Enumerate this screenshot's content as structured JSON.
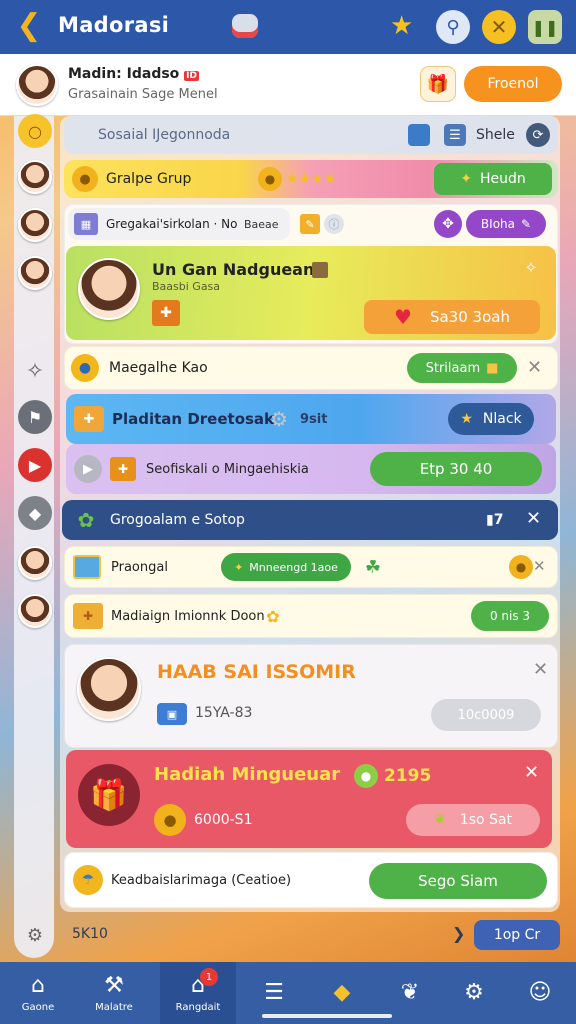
{
  "header": {
    "title": "Madorasi"
  },
  "profile": {
    "name": "Madin: Idadso",
    "flag": "ID",
    "subtitle": "Grasainain Sage Menel",
    "action": "Froenol"
  },
  "search": {
    "placeholder": "Sosaial IJegonnoda",
    "share": "Shele"
  },
  "group_row": {
    "label": "Gralpe Grup",
    "stars": "★★★★",
    "action": "Heudn"
  },
  "card1": {
    "header": "Gregakai'sirkolan · No",
    "tag": "Baeae",
    "badge": "BIoha",
    "title": "Un Gan Nadguean",
    "subtitle": "Baasbi Gasa",
    "button": "Sa30 3oah"
  },
  "card2": {
    "title": "Maegalhe Kao",
    "button": "Strilaam"
  },
  "card3": {
    "title": "Pladitan Dreetosak",
    "extra": "9sit",
    "button": "Nlack"
  },
  "card4": {
    "title": "Seofiskali o Mingaehiskia",
    "button": "Etp 30 40"
  },
  "card5": {
    "title": "Grogoalam e Sotop",
    "count": "7"
  },
  "card6": {
    "title": "Praongal",
    "pill": "Mnneengd 1aoe"
  },
  "card7": {
    "title": "Madiaign Imionnk Doon",
    "button": "0 nis 3"
  },
  "card8": {
    "title": "HAAB SAI ISSOMIR",
    "value": "15YA-83",
    "button": "10c0009"
  },
  "card9": {
    "title": "Hadiah Mingueuar",
    "count": "2195",
    "value": "6000-S1",
    "button": "1so Sat"
  },
  "card10": {
    "title": "Keadbaislarimaga (Ceatioe)",
    "button": "Sego Siam"
  },
  "footer": {
    "count": "5K10",
    "button": "1op Cr"
  },
  "nav": {
    "items": [
      "Gaone",
      "Malatre",
      "Rangdait"
    ],
    "badge": "1"
  },
  "colors": {
    "primary": "#2d57a8",
    "green": "#43b04a",
    "orange": "#f38e1f",
    "red": "#e95866",
    "yellow": "#fbd748"
  }
}
